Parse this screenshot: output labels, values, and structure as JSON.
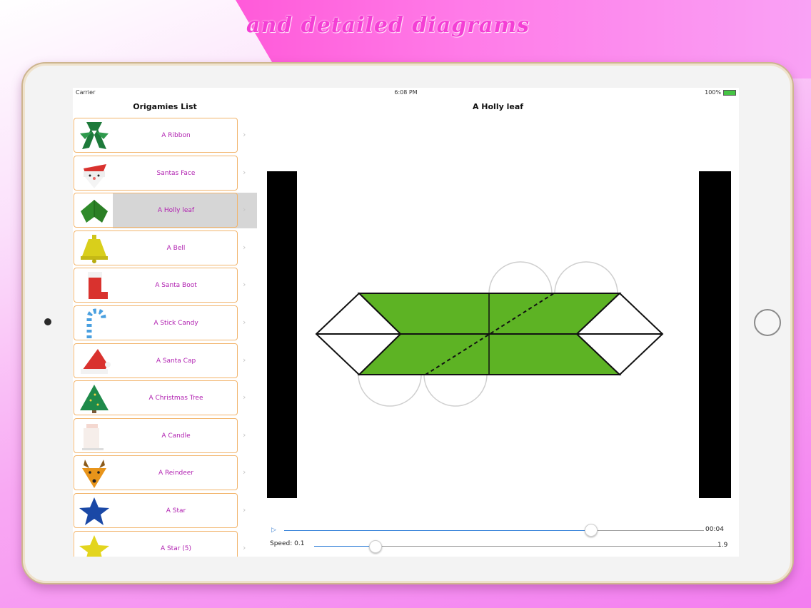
{
  "promo": {
    "headline": "and detailed diagrams"
  },
  "status_bar": {
    "carrier": "Carrier",
    "time": "6:08 PM",
    "battery": "100%"
  },
  "master": {
    "title": "Origamies List"
  },
  "detail": {
    "title": "A Holly leaf"
  },
  "list": {
    "selected_index": 2,
    "items": [
      {
        "label": "A Ribbon",
        "icon": "ribbon-icon"
      },
      {
        "label": "Santas Face",
        "icon": "santa-face-icon"
      },
      {
        "label": "A Holly leaf",
        "icon": "holly-leaf-icon"
      },
      {
        "label": "A Bell",
        "icon": "bell-icon"
      },
      {
        "label": "A Santa Boot",
        "icon": "santa-boot-icon"
      },
      {
        "label": "A Stick Candy",
        "icon": "candy-cane-icon"
      },
      {
        "label": "A Santa Cap",
        "icon": "santa-cap-icon"
      },
      {
        "label": "A Christmas Tree",
        "icon": "christmas-tree-icon"
      },
      {
        "label": "A Candle",
        "icon": "candle-icon"
      },
      {
        "label": "A Reindeer",
        "icon": "reindeer-icon"
      },
      {
        "label": "A Star",
        "icon": "star-icon"
      },
      {
        "label": "A Star (5)",
        "icon": "star-five-icon"
      }
    ]
  },
  "player": {
    "play_icon": "play-icon",
    "time": "00:04",
    "progress": 0.73,
    "speed_label": "Speed: 0.1",
    "speed_max": "1.9",
    "speed_position": 0.15
  },
  "colors": {
    "accent_pink": "#f43fd5",
    "list_label": "#b01fb0",
    "card_border": "#f2b56d",
    "slider_blue": "#2f7ed8",
    "diagram_green": "#5db324"
  }
}
